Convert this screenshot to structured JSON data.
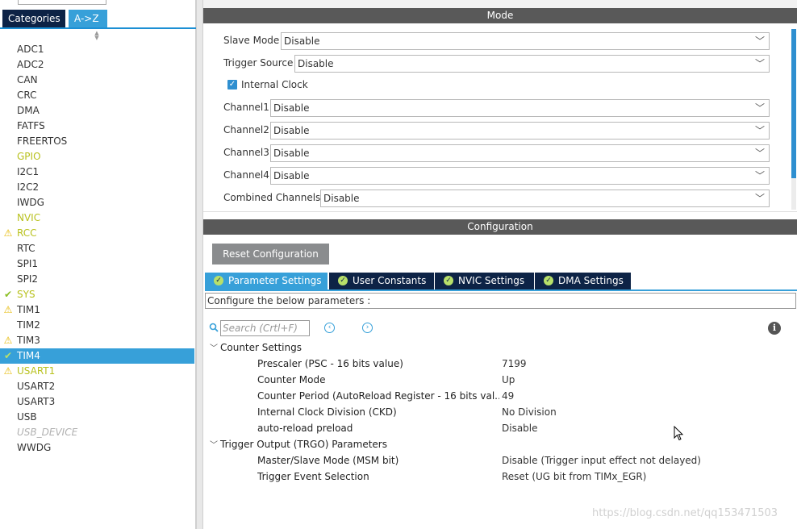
{
  "left_panel": {
    "tabs": [
      {
        "label": "Categories"
      },
      {
        "label": "A->Z"
      }
    ],
    "items": [
      {
        "label": "ADC1",
        "status": ""
      },
      {
        "label": "ADC2",
        "status": ""
      },
      {
        "label": "CAN",
        "status": ""
      },
      {
        "label": "CRC",
        "status": ""
      },
      {
        "label": "DMA",
        "status": ""
      },
      {
        "label": "FATFS",
        "status": ""
      },
      {
        "label": "FREERTOS",
        "status": ""
      },
      {
        "label": "GPIO",
        "status": "partial"
      },
      {
        "label": "I2C1",
        "status": ""
      },
      {
        "label": "I2C2",
        "status": ""
      },
      {
        "label": "IWDG",
        "status": ""
      },
      {
        "label": "NVIC",
        "status": "partial"
      },
      {
        "label": "RCC",
        "status": "warning"
      },
      {
        "label": "RTC",
        "status": ""
      },
      {
        "label": "SPI1",
        "status": ""
      },
      {
        "label": "SPI2",
        "status": ""
      },
      {
        "label": "SYS",
        "status": "ok"
      },
      {
        "label": "TIM1",
        "status": "warning-black"
      },
      {
        "label": "TIM2",
        "status": ""
      },
      {
        "label": "TIM3",
        "status": "warning-black"
      },
      {
        "label": "TIM4",
        "status": "selected-ok"
      },
      {
        "label": "USART1",
        "status": "warning"
      },
      {
        "label": "USART2",
        "status": ""
      },
      {
        "label": "USART3",
        "status": ""
      },
      {
        "label": "USB",
        "status": ""
      },
      {
        "label": "USB_DEVICE",
        "status": "disabled"
      },
      {
        "label": "WWDG",
        "status": ""
      }
    ]
  },
  "mode": {
    "title": "Mode",
    "slave_mode": {
      "label": "Slave Mode",
      "value": "Disable"
    },
    "trigger_source": {
      "label": "Trigger Source",
      "value": "Disable"
    },
    "internal_clock": {
      "label": "Internal Clock",
      "checked": true
    },
    "channel1": {
      "label": "Channel1",
      "value": "Disable"
    },
    "channel2": {
      "label": "Channel2",
      "value": "Disable"
    },
    "channel3": {
      "label": "Channel3",
      "value": "Disable"
    },
    "channel4": {
      "label": "Channel4",
      "value": "Disable"
    },
    "combined": {
      "label": "Combined Channels",
      "value": "Disable"
    }
  },
  "configuration": {
    "title": "Configuration",
    "reset_label": "Reset Configuration",
    "tabs": [
      {
        "label": "Parameter Settings"
      },
      {
        "label": "User Constants"
      },
      {
        "label": "NVIC Settings"
      },
      {
        "label": "DMA Settings"
      }
    ],
    "description": "Configure the below parameters :",
    "search_placeholder": "Search (Crtl+F)",
    "groups": [
      {
        "title": "Counter Settings",
        "params": [
          {
            "name": "Prescaler (PSC - 16 bits value)",
            "value": "7199"
          },
          {
            "name": "Counter Mode",
            "value": "Up"
          },
          {
            "name": "Counter Period (AutoReload Register - 16 bits val...",
            "value": "49"
          },
          {
            "name": "Internal Clock Division (CKD)",
            "value": "No Division"
          },
          {
            "name": "auto-reload preload",
            "value": "Disable"
          }
        ]
      },
      {
        "title": "Trigger Output (TRGO) Parameters",
        "params": [
          {
            "name": "Master/Slave Mode (MSM bit)",
            "value": "Disable (Trigger input effect not delayed)"
          },
          {
            "name": "Trigger Event Selection",
            "value": "Reset (UG bit from TIMx_EGR)"
          }
        ]
      }
    ]
  },
  "watermark": "https://blog.csdn.net/qq153471503",
  "colors": {
    "accent": "#37a0d9",
    "navy": "#0d2346",
    "header_gray": "#595959",
    "warning": "#e6b800",
    "ok": "#8cbf26"
  }
}
